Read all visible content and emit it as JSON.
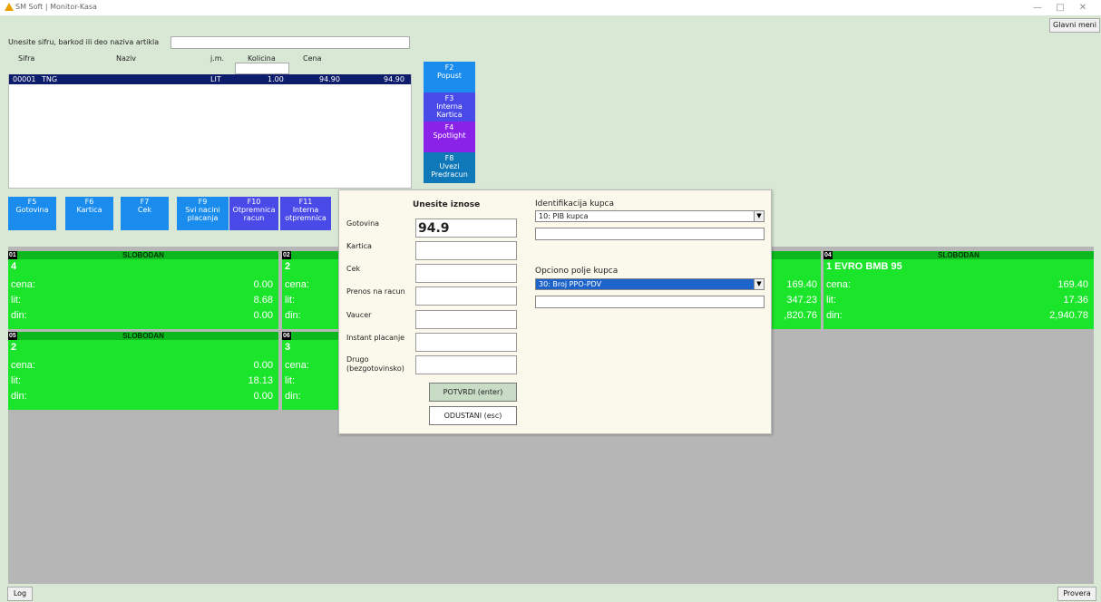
{
  "window": {
    "title": "SM Soft | Monitor-Kasa",
    "minimize": "—",
    "maximize": "□",
    "close": "✕"
  },
  "toolbar": {
    "main_menu": "Glavni meni"
  },
  "search": {
    "label": "Unesite sifru, barkod ili deo naziva artikla",
    "value": ""
  },
  "columns": {
    "code": "Sifra",
    "name": "Naziv",
    "unit": "j.m.",
    "qty": "Kolicina",
    "price": "Cena"
  },
  "item": {
    "code": "00001",
    "name": "TNG",
    "unit": "LIT",
    "qty": "1.00",
    "price": "94.90",
    "total": "94.90"
  },
  "side_buttons": [
    {
      "key": "F2",
      "label": "Popust",
      "color": "#1a8cee"
    },
    {
      "key": "F3",
      "label": "Interna Kartica",
      "color": "#4a4ae8"
    },
    {
      "key": "F4",
      "label": "Spotlight",
      "color": "#8b22e8"
    },
    {
      "key": "F8",
      "label": "Uvezi Predracun",
      "color": "#0e78b8"
    }
  ],
  "function_buttons": [
    {
      "key": "F5",
      "label": "Gotovina",
      "color": "#1a8cee"
    },
    {
      "key": "F6",
      "label": "Kartica",
      "color": "#1a8cee"
    },
    {
      "key": "F7",
      "label": "Cek",
      "color": "#1a8cee"
    },
    {
      "key": "F9",
      "label": "Svi nacini placanja",
      "color": "#1a8cee"
    },
    {
      "key": "F10",
      "label": "Otpremnica racun",
      "color": "#4a4ae8"
    },
    {
      "key": "F11",
      "label": "Interna otpremnica",
      "color": "#4a4ae8"
    }
  ],
  "panels": [
    {
      "num": "01",
      "status": "SLOBODAN",
      "product": "4",
      "cena_label": "cena:",
      "cena": "0.00",
      "lit_label": "lit:",
      "lit": "8.68",
      "din_label": "din:",
      "din": "0.00"
    },
    {
      "num": "02",
      "product": "2",
      "cena_label": "cena:",
      "lit_label": "lit:",
      "din_label": "din:"
    },
    {
      "cena": "169.40",
      "lit": "347.23",
      "din": ",820.76"
    },
    {
      "num": "04",
      "status": "SLOBODAN",
      "product": "1 EVRO BMB 95",
      "cena_label": "cena:",
      "cena": "169.40",
      "lit_label": "lit:",
      "lit": "17.36",
      "din_label": "din:",
      "din": "2,940.78"
    },
    {
      "num": "05",
      "status": "SLOBODAN",
      "product": "2",
      "cena_label": "cena:",
      "cena": "0.00",
      "lit_label": "lit:",
      "lit": "18.13",
      "din_label": "din:",
      "din": "0.00"
    },
    {
      "num": "06",
      "product": "3",
      "cena_label": "cena:",
      "lit_label": "lit:",
      "din_label": "din:"
    }
  ],
  "dialog": {
    "title": "Unesite iznose",
    "fields": [
      {
        "label": "Gotovina",
        "value": "94.9"
      },
      {
        "label": "Kartica",
        "value": ""
      },
      {
        "label": "Cek",
        "value": ""
      },
      {
        "label": "Prenos na racun",
        "value": ""
      },
      {
        "label": "Vaucer",
        "value": ""
      },
      {
        "label": "Instant placanje",
        "value": ""
      },
      {
        "label": "Drugo (bezgotovinsko)",
        "value": ""
      }
    ],
    "confirm": "POTVRDI (enter)",
    "cancel": "ODUSTANI (esc)",
    "id_label": "Identifikacija kupca",
    "id_select": "10: PIB kupca",
    "opt_label": "Opciono polje kupca",
    "opt_select": "30: Broj PPO-PDV"
  },
  "bottom": {
    "log": "Log",
    "check": "Provera"
  },
  "colors": {
    "background": "#d9e8d5",
    "panel_green": "#1be52a",
    "selected_row": "#0d1c6b",
    "select_highlight": "#1d63c9"
  }
}
